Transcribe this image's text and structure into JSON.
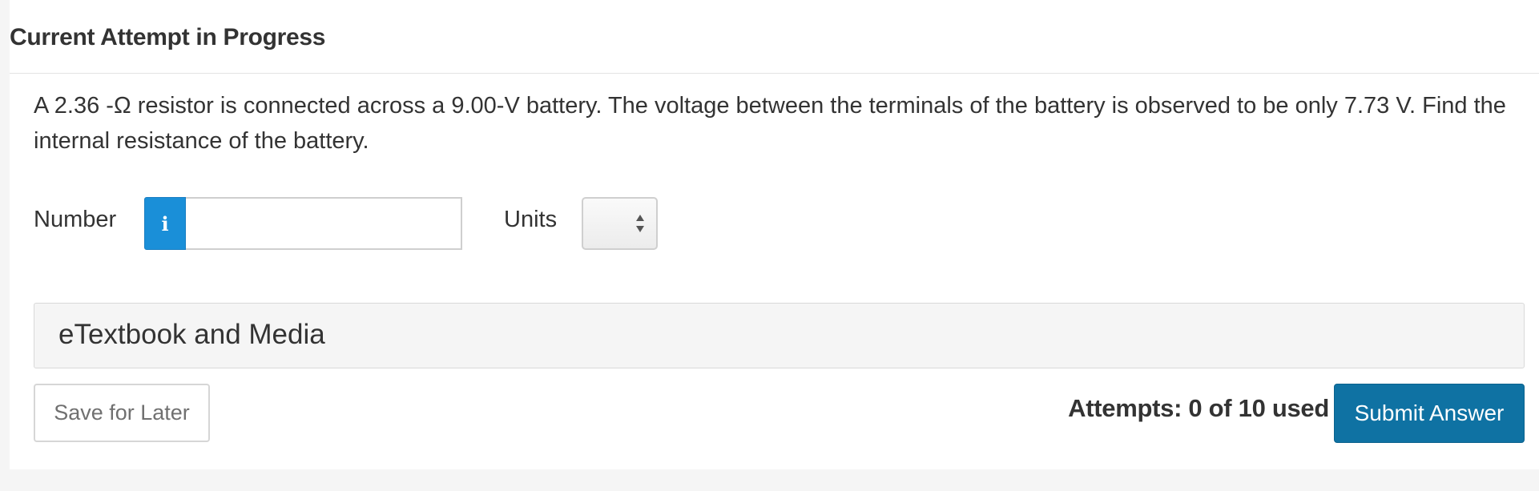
{
  "header": {
    "title": "Current Attempt in Progress"
  },
  "question": {
    "text": "A  2.36 -Ω resistor is connected across a 9.00-V battery. The voltage between the terminals of the battery is observed to be only  7.73 V. Find the internal resistance of the battery."
  },
  "answer": {
    "number_label": "Number",
    "info_icon_glyph": "i",
    "number_value": "",
    "number_placeholder": "",
    "units_label": "Units",
    "units_selected": ""
  },
  "media": {
    "label": "eTextbook and Media"
  },
  "footer": {
    "save_label": "Save for Later",
    "attempts_text": "Attempts: 0 of 10 used",
    "submit_label": "Submit Answer"
  },
  "colors": {
    "info_button": "#1a8fd8",
    "submit_button": "#0f72a3",
    "media_bar": "#f5f5f5"
  },
  "icons": {
    "info": "info-icon",
    "select_arrows": "up-down-arrows-icon"
  }
}
